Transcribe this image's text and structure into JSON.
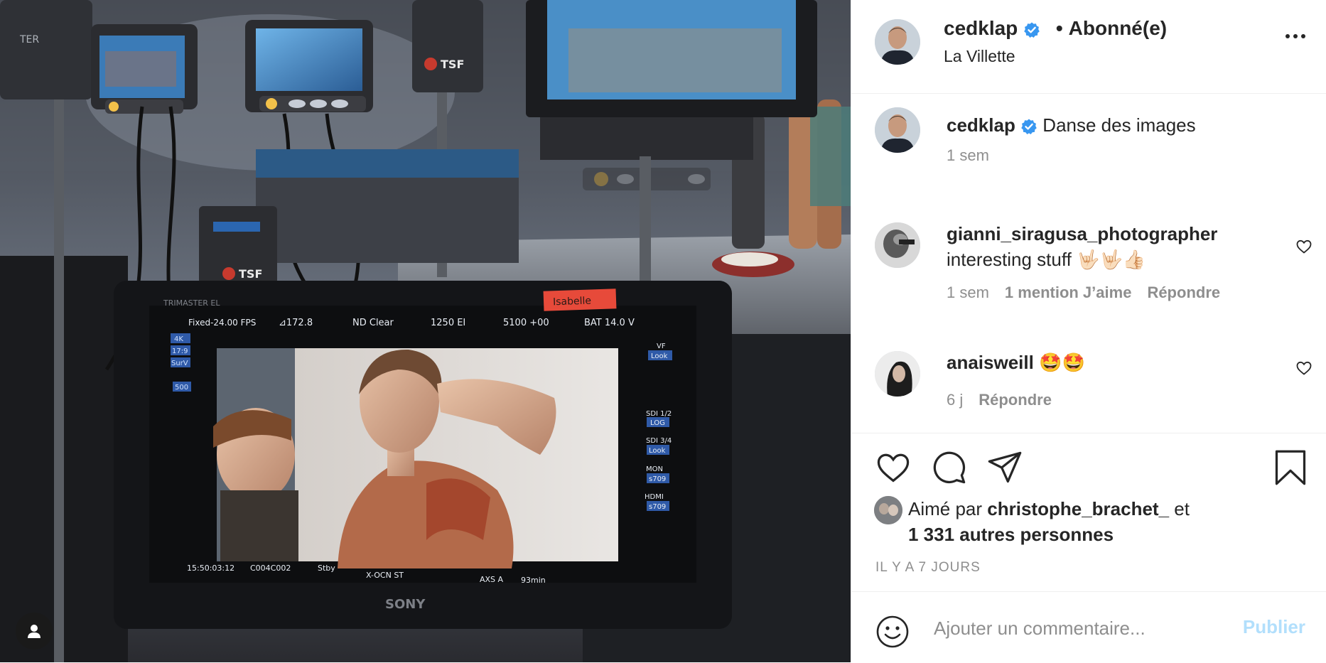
{
  "post": {
    "author": "cedklap",
    "follow_separator": "•",
    "follow_status": "Abonné(e)",
    "location": "La Villette",
    "more_icon": "more-horizontal-icon"
  },
  "monitor": {
    "brand": "TRIMASTER EL",
    "maker": "SONY",
    "tape_label": "Isabelle",
    "top_readouts": [
      "Fixed-24.00 FPS",
      "⊿172.8",
      "ND Clear",
      "1250 EI",
      "5100 +00",
      "BAT 14.0 V"
    ],
    "left_tags": [
      "4K",
      "17:9",
      "SurV",
      "500"
    ],
    "right_tags": [
      {
        "top": "VF",
        "bottom": "Look"
      },
      {
        "top": "SDI 1/2",
        "bottom": "LOG"
      },
      {
        "top": "SDI 3/4",
        "bottom": "Look"
      },
      {
        "top": "MON",
        "bottom": "s709"
      },
      {
        "top": "HDMI",
        "bottom": "s709"
      }
    ],
    "bottom_readouts": [
      "15:50:03:12",
      "C004C002",
      "Stby",
      "X-OCN ST",
      "AXS A",
      "93min"
    ]
  },
  "caption": {
    "author": "cedklap",
    "text": "Danse des images",
    "time": "1 sem"
  },
  "comments": [
    {
      "author": "gianni_siragusa_photographer",
      "text": "interesting stuff 🤟🏻🤟🏻👍🏻",
      "time": "1 sem",
      "likes": "1 mention J’aime",
      "reply": "Répondre"
    },
    {
      "author": "anaisweill",
      "text": "🤩🤩",
      "time": "6 j",
      "reply": "Répondre"
    }
  ],
  "likes": {
    "prefix": "Aimé par",
    "user": "christophe_brachet_",
    "conj": "et",
    "others": "1 331 autres personnes"
  },
  "timestamp": "IL Y A 7 JOURS",
  "composer": {
    "placeholder": "Ajouter un commentaire...",
    "publish": "Publier"
  },
  "colors": {
    "text": "#262626",
    "muted": "#8e8e8e",
    "verified": "#3897f0",
    "publish_disabled": "#b2dffc",
    "divider": "#efefef"
  }
}
